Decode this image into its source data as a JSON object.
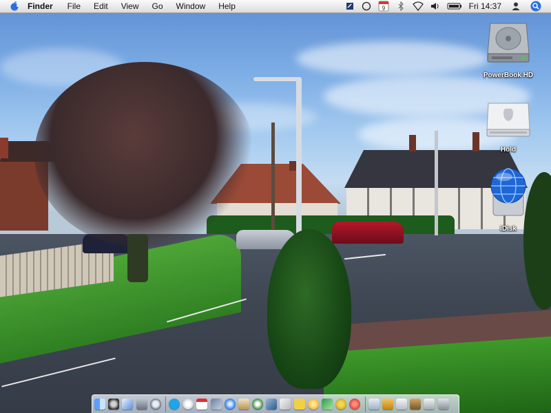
{
  "menubar": {
    "apple_icon": "apple-logo-icon",
    "app_name": "Finder",
    "menus": [
      "File",
      "Edit",
      "View",
      "Go",
      "Window",
      "Help"
    ],
    "status_icons": [
      "script-menu-icon",
      "clock-icon",
      "ical-icon",
      "bluetooth-icon",
      "airport-wifi-icon",
      "volume-icon",
      "battery-icon",
      "user-icon",
      "spotlight-icon"
    ],
    "calendar_day": "9",
    "clock": "Fri 14:37"
  },
  "desktop": {
    "icons": [
      {
        "label": "PowerBook HD",
        "icon": "hard-drive-icon"
      },
      {
        "label": "Hold",
        "icon": "external-drive-icon"
      },
      {
        "label": "iDisk",
        "icon": "idisk-icon"
      }
    ]
  },
  "dock": {
    "items": [
      "finder-icon",
      "dashboard-icon",
      "mail-icon",
      "system-preferences-icon",
      "software-update-icon",
      "skype-icon",
      "ichat-icon",
      "ical-icon",
      "preview-icon",
      "safari-icon",
      "address-book-icon",
      "itunes-icon",
      "iphoto-icon",
      "text-edit-icon",
      "stickies-icon",
      "terminal-icon",
      "network-icon",
      "application-icon",
      "text-document-icon",
      "folder-icon",
      "downloads-icon",
      "image-document-icon",
      "stack-icon",
      "window-icon",
      "trash-icon"
    ]
  }
}
